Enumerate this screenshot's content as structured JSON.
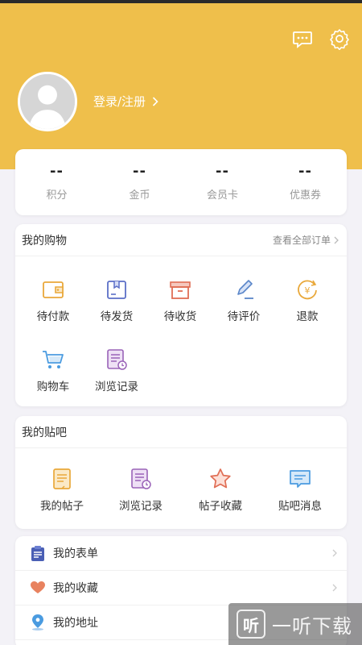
{
  "header": {
    "login_text": "登录/注册",
    "bg_color": "#efbf4b",
    "icons": [
      "message-icon",
      "settings-icon"
    ]
  },
  "stats": [
    {
      "value": "--",
      "label": "积分"
    },
    {
      "value": "--",
      "label": "金币"
    },
    {
      "value": "--",
      "label": "会员卡"
    },
    {
      "value": "--",
      "label": "优惠券"
    }
  ],
  "shopping": {
    "title": "我的购物",
    "view_all": "查看全部订单",
    "items": [
      {
        "label": "待付款",
        "icon": "wallet-icon"
      },
      {
        "label": "待发货",
        "icon": "package-icon"
      },
      {
        "label": "待收货",
        "icon": "receive-box-icon"
      },
      {
        "label": "待评价",
        "icon": "pen-icon"
      },
      {
        "label": "退款",
        "icon": "refund-icon"
      },
      {
        "label": "购物车",
        "icon": "cart-icon"
      },
      {
        "label": "浏览记录",
        "icon": "history-icon"
      }
    ]
  },
  "tieba": {
    "title": "我的贴吧",
    "items": [
      {
        "label": "我的帖子",
        "icon": "post-icon"
      },
      {
        "label": "浏览记录",
        "icon": "history-icon"
      },
      {
        "label": "帖子收藏",
        "icon": "star-icon"
      },
      {
        "label": "贴吧消息",
        "icon": "message-icon"
      }
    ]
  },
  "menu": [
    {
      "label": "我的表单",
      "icon": "clipboard-icon"
    },
    {
      "label": "我的收藏",
      "icon": "heart-icon"
    },
    {
      "label": "我的地址",
      "icon": "location-icon"
    }
  ],
  "watermark": {
    "logo": "听",
    "text": "一听下载"
  }
}
